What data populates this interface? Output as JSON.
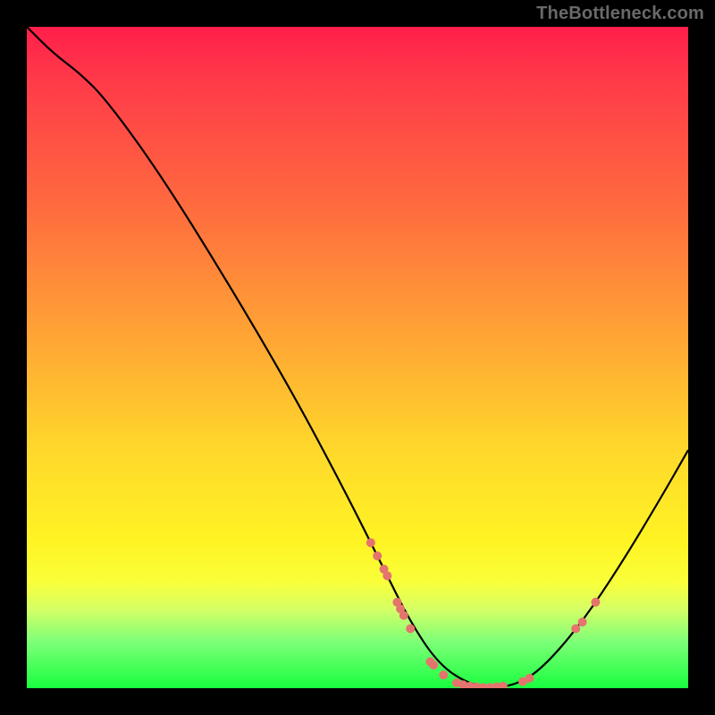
{
  "watermark": "TheBottleneck.com",
  "colors": {
    "marker": "#e4746d",
    "curve": "#000000"
  },
  "chart_data": {
    "type": "line",
    "title": "",
    "xlabel": "",
    "ylabel": "",
    "xlim": [
      0,
      100
    ],
    "ylim": [
      0,
      100
    ],
    "curve": [
      {
        "x": 0,
        "y": 100
      },
      {
        "x": 4,
        "y": 96
      },
      {
        "x": 8,
        "y": 93
      },
      {
        "x": 12,
        "y": 89
      },
      {
        "x": 20,
        "y": 78
      },
      {
        "x": 30,
        "y": 62
      },
      {
        "x": 40,
        "y": 45
      },
      {
        "x": 48,
        "y": 30
      },
      {
        "x": 54,
        "y": 18
      },
      {
        "x": 58,
        "y": 10
      },
      {
        "x": 62,
        "y": 4
      },
      {
        "x": 66,
        "y": 1
      },
      {
        "x": 70,
        "y": 0
      },
      {
        "x": 74,
        "y": 0.5
      },
      {
        "x": 78,
        "y": 3
      },
      {
        "x": 84,
        "y": 10
      },
      {
        "x": 90,
        "y": 19
      },
      {
        "x": 96,
        "y": 29
      },
      {
        "x": 100,
        "y": 36
      }
    ],
    "markers": [
      {
        "x": 52,
        "y": 22,
        "r": 5
      },
      {
        "x": 53,
        "y": 20,
        "r": 5
      },
      {
        "x": 54,
        "y": 18,
        "r": 5
      },
      {
        "x": 54.5,
        "y": 17,
        "r": 5
      },
      {
        "x": 56,
        "y": 13,
        "r": 5
      },
      {
        "x": 56.5,
        "y": 12,
        "r": 5
      },
      {
        "x": 57,
        "y": 11,
        "r": 5
      },
      {
        "x": 58,
        "y": 9,
        "r": 5
      },
      {
        "x": 61,
        "y": 4,
        "r": 5
      },
      {
        "x": 61.5,
        "y": 3.5,
        "r": 5
      },
      {
        "x": 63,
        "y": 2,
        "r": 5
      },
      {
        "x": 65,
        "y": 0.8,
        "r": 5
      },
      {
        "x": 66,
        "y": 0.5,
        "r": 5
      },
      {
        "x": 67,
        "y": 0.3,
        "r": 5
      },
      {
        "x": 68,
        "y": 0.2,
        "r": 5
      },
      {
        "x": 69,
        "y": 0.1,
        "r": 5
      },
      {
        "x": 70,
        "y": 0.1,
        "r": 5
      },
      {
        "x": 71,
        "y": 0.2,
        "r": 5
      },
      {
        "x": 72,
        "y": 0.3,
        "r": 5
      },
      {
        "x": 75,
        "y": 1,
        "r": 5
      },
      {
        "x": 76,
        "y": 1.5,
        "r": 5
      },
      {
        "x": 83,
        "y": 9,
        "r": 5
      },
      {
        "x": 84,
        "y": 10,
        "r": 5
      },
      {
        "x": 86,
        "y": 13,
        "r": 5
      }
    ]
  }
}
